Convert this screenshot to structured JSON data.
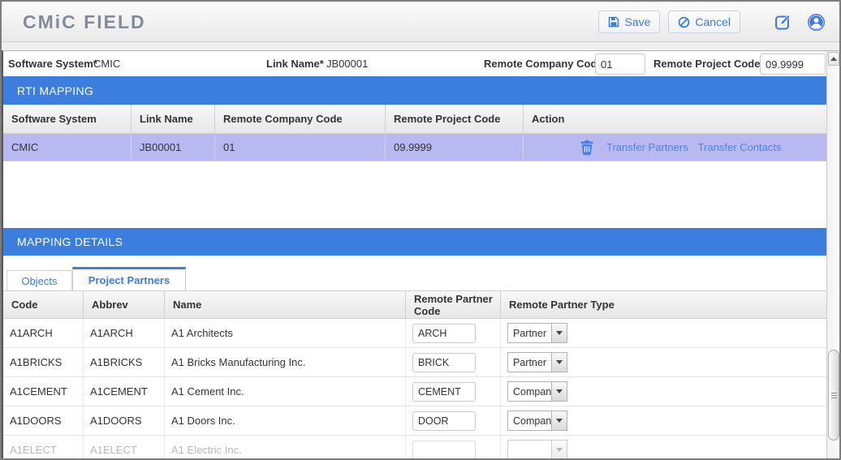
{
  "header": {
    "logo": "CMiC FIELD",
    "save_label": "Save",
    "cancel_label": "Cancel"
  },
  "form": {
    "software_system": {
      "label": "Software System*",
      "value": "CMIC"
    },
    "link_name": {
      "label": "Link Name*",
      "value": "JB00001"
    },
    "remote_company_code": {
      "label": "Remote Company Code*",
      "value": "01"
    },
    "remote_project_code": {
      "label": "Remote Project Code*",
      "value": "09.9999"
    }
  },
  "rti_mapping": {
    "title": "RTI MAPPING",
    "columns": [
      "Software System",
      "Link Name",
      "Remote Company Code",
      "Remote Project Code",
      "Action"
    ],
    "row": {
      "software_system": "CMIC",
      "link_name": "JB00001",
      "remote_company_code": "01",
      "remote_project_code": "09.9999",
      "action_links": [
        "Transfer Partners",
        "Transfer Contacts"
      ]
    }
  },
  "mapping_details": {
    "title": "MAPPING DETAILS",
    "tabs": [
      {
        "label": "Objects",
        "active": false
      },
      {
        "label": "Project Partners",
        "active": true
      }
    ],
    "columns": [
      "Code",
      "Abbrev",
      "Name",
      "Remote Partner Code",
      "Remote Partner Type"
    ],
    "rows": [
      {
        "code": "A1ARCH",
        "abbrev": "A1ARCH",
        "name": "A1 Architects",
        "remote_partner_code": "ARCH",
        "remote_partner_type": "Partner"
      },
      {
        "code": "A1BRICKS",
        "abbrev": "A1BRICKS",
        "name": "A1 Bricks Manufacturing Inc.",
        "remote_partner_code": "BRICK",
        "remote_partner_type": "Partner"
      },
      {
        "code": "A1CEMENT",
        "abbrev": "A1CEMENT",
        "name": "A1 Cement Inc.",
        "remote_partner_code": "CEMENT",
        "remote_partner_type": "Company"
      },
      {
        "code": "A1DOORS",
        "abbrev": "A1DOORS",
        "name": "A1 Doors Inc.",
        "remote_partner_code": "DOOR",
        "remote_partner_type": "Company"
      },
      {
        "code": "A1ELECT",
        "abbrev": "A1ELECT",
        "name": "A1 Electric Inc.",
        "remote_partner_code": "",
        "remote_partner_type": ""
      }
    ]
  },
  "colors": {
    "accent_blue": "#3c7ede",
    "row_highlight": "#b9b9f1",
    "link_blue": "#4a86e0",
    "button_blue": "#3b7cd6"
  }
}
